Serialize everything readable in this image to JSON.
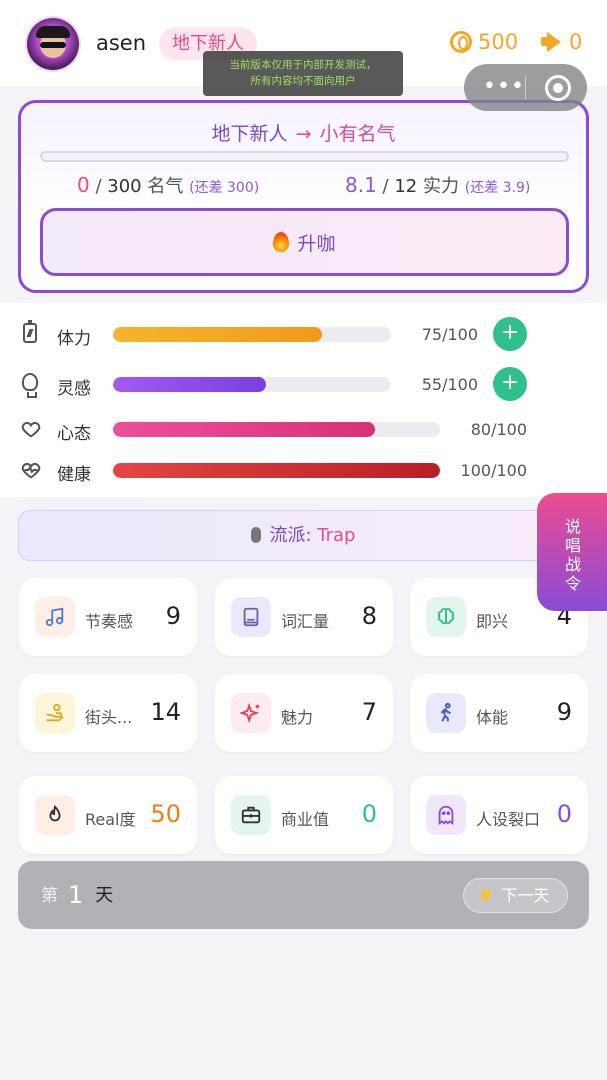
{
  "header": {
    "username": "asen",
    "rank": "地下新人",
    "coins": "500",
    "notices": "0",
    "dev_notice_line1": "当前版本仅用于内部开发测试，",
    "dev_notice_line2": "所有内容均不面向用户",
    "capsule_more": "•••"
  },
  "promotion": {
    "from": "地下新人",
    "arrow": "→",
    "to": "小有名气",
    "progress": 0.0,
    "fame_current": "0",
    "fame_sep": "/",
    "fame_target": "300",
    "fame_label": "名气",
    "fame_diff": "(还差 300)",
    "power_current": "8.1",
    "power_sep": "/",
    "power_target": "12",
    "power_label": "实力",
    "power_diff": "(还差 3.9)",
    "button_label": "升咖"
  },
  "vitals": [
    {
      "label": "体力",
      "value": "75/100",
      "level": 0.75,
      "icon": "battery-icon",
      "has_plus": true,
      "color_from": "#f5b52a",
      "color_to": "#f19a1a"
    },
    {
      "label": "灵感",
      "value": "55/100",
      "level": 0.55,
      "icon": "bulb-icon",
      "has_plus": true,
      "color_from": "#a35bf0",
      "color_to": "#7a3fe0"
    },
    {
      "label": "心态",
      "value": "80/100",
      "level": 0.8,
      "icon": "heart-icon",
      "has_plus": false,
      "color_from": "#ee4f9a",
      "color_to": "#d8317a"
    },
    {
      "label": "健康",
      "value": "100/100",
      "level": 1.0,
      "icon": "heart-pulse-icon",
      "has_plus": false,
      "color_from": "#e54545",
      "color_to": "#b81f25"
    }
  ],
  "plus_label": "+",
  "genre": {
    "label": "流派: ",
    "value": "Trap"
  },
  "side_tab": [
    "说",
    "唱",
    "战",
    "令"
  ],
  "stats": [
    {
      "label": "节奏感",
      "value": "9",
      "icon": "music-note-icon",
      "bg": "#fdeee6",
      "fg": "#4a7bd8",
      "vcolor": "#222222"
    },
    {
      "label": "词汇量",
      "value": "8",
      "icon": "book-icon",
      "bg": "#ece8fa",
      "fg": "#6b5fb0",
      "vcolor": "#222222"
    },
    {
      "label": "即兴",
      "value": "4",
      "icon": "brain-icon",
      "bg": "#e4f6ec",
      "fg": "#2ec189",
      "vcolor": "#222222"
    },
    {
      "label": "街头...",
      "value": "14",
      "icon": "hand-icon",
      "bg": "#fdf5d8",
      "fg": "#e0a818",
      "vcolor": "#222222"
    },
    {
      "label": "魅力",
      "value": "7",
      "icon": "sparkles-icon",
      "bg": "#fdecef",
      "fg": "#e2424f",
      "vcolor": "#222222"
    },
    {
      "label": "体能",
      "value": "9",
      "icon": "runner-icon",
      "bg": "#e8eafc",
      "fg": "#4a55d0",
      "vcolor": "#222222"
    },
    {
      "label": "Real度",
      "value": "50",
      "icon": "flame-icon",
      "bg": "#fdeee6",
      "fg": "#333333",
      "vcolor": "#e8801a"
    },
    {
      "label": "商业值",
      "value": "0",
      "icon": "briefcase-icon",
      "bg": "#e4f6ec",
      "fg": "#333333",
      "vcolor": "#2ec189"
    },
    {
      "label": "人设裂口",
      "value": "0",
      "icon": "ghost-icon",
      "bg": "#f0e8fa",
      "fg": "#8a4bd6",
      "vcolor": "#8a4bd6"
    }
  ],
  "day": {
    "prefix": "第",
    "number": "1",
    "suffix": "天",
    "next_label": "下一天"
  }
}
